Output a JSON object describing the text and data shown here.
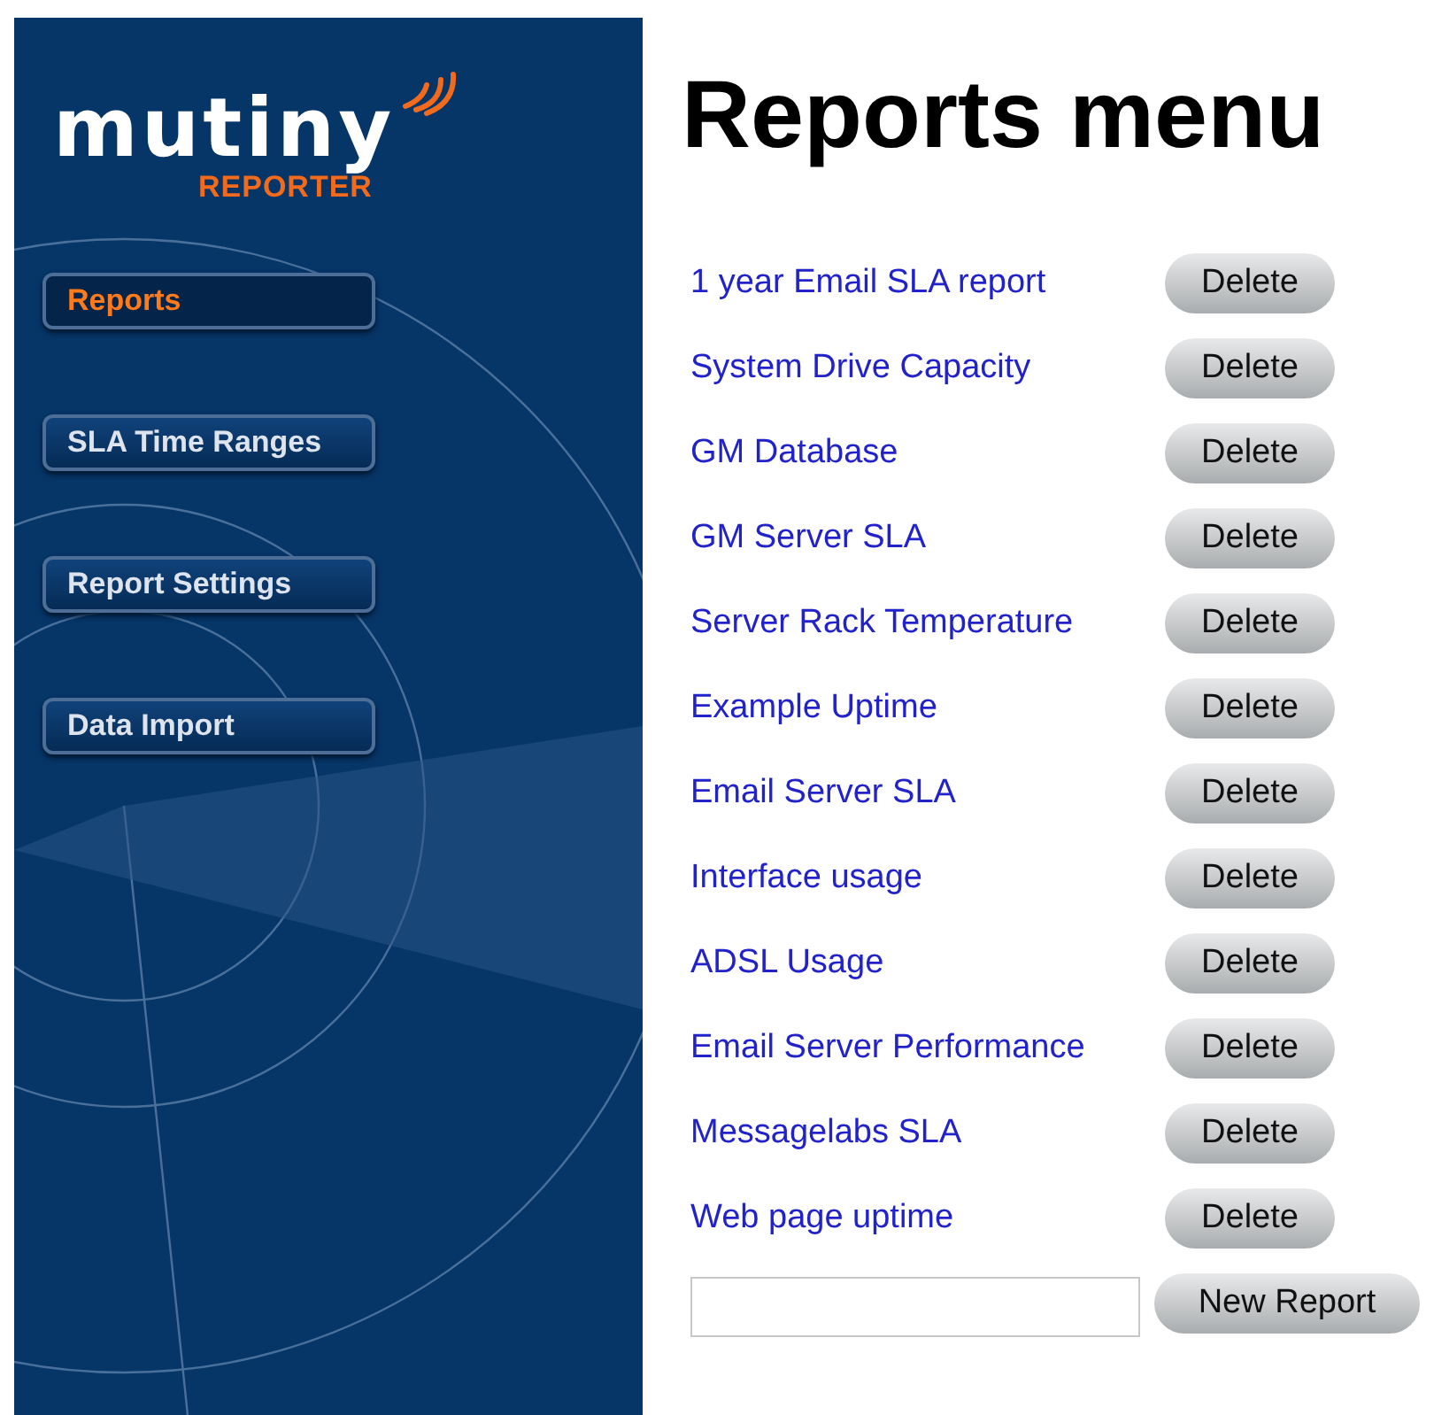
{
  "logo": {
    "name": "mutiny",
    "subtitle": "REPORTER"
  },
  "nav": [
    {
      "label": "Reports",
      "selected": true
    },
    {
      "label": "SLA Time Ranges",
      "selected": false
    },
    {
      "label": "Report Settings",
      "selected": false
    },
    {
      "label": "Data Import",
      "selected": false
    }
  ],
  "title": "Reports menu",
  "reports": [
    {
      "name": "1 year Email SLA report",
      "action": "Delete"
    },
    {
      "name": "System Drive Capacity",
      "action": "Delete"
    },
    {
      "name": "GM Database",
      "action": "Delete"
    },
    {
      "name": "GM Server SLA",
      "action": "Delete"
    },
    {
      "name": "Server Rack Temperature",
      "action": "Delete"
    },
    {
      "name": "Example Uptime",
      "action": "Delete"
    },
    {
      "name": "Email Server SLA",
      "action": "Delete"
    },
    {
      "name": "Interface usage",
      "action": "Delete"
    },
    {
      "name": "ADSL Usage",
      "action": "Delete"
    },
    {
      "name": "Email Server Performance",
      "action": "Delete"
    },
    {
      "name": "Messagelabs SLA",
      "action": "Delete"
    },
    {
      "name": "Web page uptime",
      "action": "Delete"
    }
  ],
  "new_report_button": "New Report"
}
